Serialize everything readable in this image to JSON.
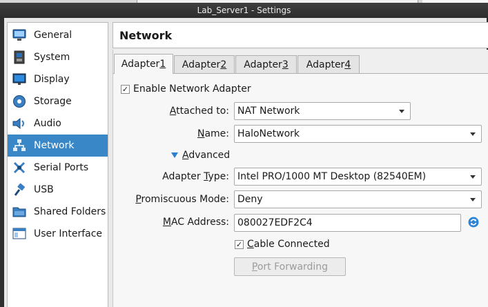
{
  "window": {
    "title": "Lab_Server1 - Settings"
  },
  "sidebar": {
    "items": [
      {
        "label": "General",
        "icon": "monitor-icon"
      },
      {
        "label": "System",
        "icon": "chip-icon"
      },
      {
        "label": "Display",
        "icon": "display-icon"
      },
      {
        "label": "Storage",
        "icon": "disk-icon"
      },
      {
        "label": "Audio",
        "icon": "speaker-icon"
      },
      {
        "label": "Network",
        "icon": "network-icon",
        "active": true
      },
      {
        "label": "Serial Ports",
        "icon": "serial-port-icon"
      },
      {
        "label": "USB",
        "icon": "usb-icon"
      },
      {
        "label": "Shared Folders",
        "icon": "folder-icon"
      },
      {
        "label": "User Interface",
        "icon": "window-icon"
      }
    ]
  },
  "page": {
    "title": "Network"
  },
  "tabs": [
    {
      "prefix": "Adapter ",
      "key": "1",
      "active": true
    },
    {
      "prefix": "Adapter ",
      "key": "2"
    },
    {
      "prefix": "Adapter ",
      "key": "3"
    },
    {
      "prefix": "Adapter ",
      "key": "4"
    }
  ],
  "adapter": {
    "enable": {
      "label": "Enable Network Adapter",
      "checked": true,
      "check_glyph": "✓"
    },
    "attached_to": {
      "label_key": "A",
      "label_rest": "ttached to:",
      "value": "NAT Network"
    },
    "name": {
      "label_key": "N",
      "label_rest": "ame:",
      "value": "HaloNetwork"
    },
    "advanced": {
      "label_key": "A",
      "label_rest": "dvanced"
    },
    "adapter_type": {
      "label_pre": "Adapter ",
      "label_key": "T",
      "label_rest": "ype:",
      "value": "Intel PRO/1000 MT Desktop (82540EM)"
    },
    "promiscuous": {
      "label_key": "P",
      "label_rest": "romiscuous Mode:",
      "value": "Deny"
    },
    "mac": {
      "label_key": "M",
      "label_rest": "AC Address:",
      "value": "080027EDF2C4"
    },
    "cable": {
      "label_key": "C",
      "label_rest": "able Connected",
      "checked": true,
      "check_glyph": "✓"
    },
    "port_forwarding": {
      "label_key": "P",
      "label_rest": "ort Forwarding",
      "enabled": false
    }
  },
  "colors": {
    "accent": "#3a87c8",
    "titlebar": "#333333"
  }
}
